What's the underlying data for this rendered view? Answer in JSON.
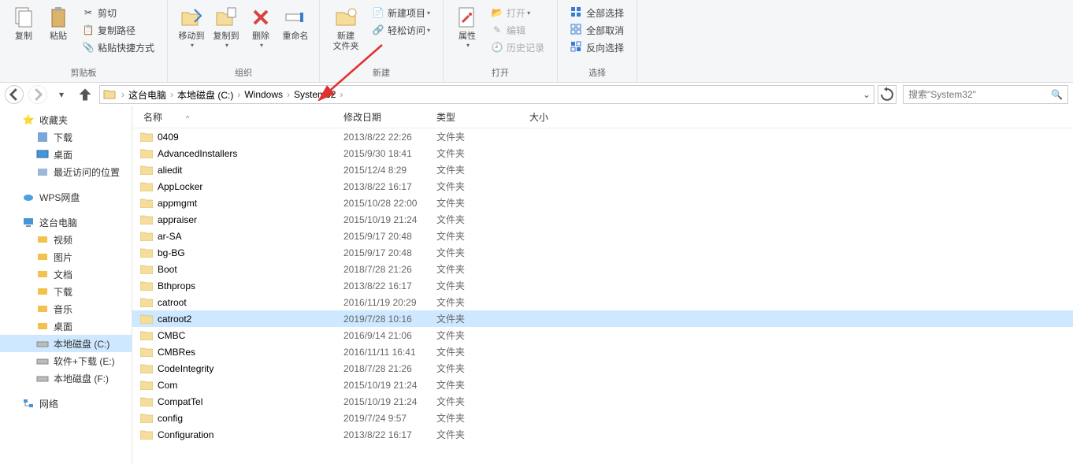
{
  "ribbon": {
    "group1": {
      "label": "剪贴板",
      "copy": "复制",
      "paste": "粘贴",
      "cut": "剪切",
      "copypath": "复制路径",
      "pasteshort": "粘贴快捷方式"
    },
    "group2": {
      "label": "组织",
      "moveto": "移动到",
      "copyto": "复制到",
      "delete": "删除",
      "rename": "重命名"
    },
    "group3": {
      "label": "新建",
      "newfolder": "新建\n文件夹",
      "newitem": "新建项目",
      "easy": "轻松访问"
    },
    "group4": {
      "label": "打开",
      "props": "属性",
      "open": "打开",
      "edit": "编辑",
      "history": "历史记录"
    },
    "group5": {
      "label": "选择",
      "sel_all": "全部选择",
      "sel_none": "全部取消",
      "sel_inv": "反向选择"
    }
  },
  "breadcrumbs": [
    "这台电脑",
    "本地磁盘 (C:)",
    "Windows",
    "System32"
  ],
  "search_placeholder": "搜索\"System32\"",
  "columns": {
    "name": "名称",
    "date": "修改日期",
    "type": "类型",
    "size": "大小"
  },
  "sidebar": {
    "fav": "收藏夹",
    "downloads": "下载",
    "desktop": "桌面",
    "recent": "最近访问的位置",
    "wps": "WPS网盘",
    "thispc": "这台电脑",
    "video": "视频",
    "pictures": "图片",
    "docs": "文档",
    "dl2": "下载",
    "music": "音乐",
    "desk2": "桌面",
    "cdrive": "本地磁盘 (C:)",
    "edrive": "软件+下载 (E:)",
    "fdrive": "本地磁盘 (F:)",
    "network": "网络"
  },
  "files": [
    {
      "name": "0409",
      "date": "2013/8/22 22:26",
      "type": "文件夹",
      "sel": false
    },
    {
      "name": "AdvancedInstallers",
      "date": "2015/9/30 18:41",
      "type": "文件夹",
      "sel": false
    },
    {
      "name": "aliedit",
      "date": "2015/12/4 8:29",
      "type": "文件夹",
      "sel": false
    },
    {
      "name": "AppLocker",
      "date": "2013/8/22 16:17",
      "type": "文件夹",
      "sel": false
    },
    {
      "name": "appmgmt",
      "date": "2015/10/28 22:00",
      "type": "文件夹",
      "sel": false
    },
    {
      "name": "appraiser",
      "date": "2015/10/19 21:24",
      "type": "文件夹",
      "sel": false
    },
    {
      "name": "ar-SA",
      "date": "2015/9/17 20:48",
      "type": "文件夹",
      "sel": false
    },
    {
      "name": "bg-BG",
      "date": "2015/9/17 20:48",
      "type": "文件夹",
      "sel": false
    },
    {
      "name": "Boot",
      "date": "2018/7/28 21:26",
      "type": "文件夹",
      "sel": false
    },
    {
      "name": "Bthprops",
      "date": "2013/8/22 16:17",
      "type": "文件夹",
      "sel": false
    },
    {
      "name": "catroot",
      "date": "2016/11/19 20:29",
      "type": "文件夹",
      "sel": false
    },
    {
      "name": "catroot2",
      "date": "2019/7/28 10:16",
      "type": "文件夹",
      "sel": true
    },
    {
      "name": "CMBC",
      "date": "2016/9/14 21:06",
      "type": "文件夹",
      "sel": false
    },
    {
      "name": "CMBRes",
      "date": "2016/11/11 16:41",
      "type": "文件夹",
      "sel": false
    },
    {
      "name": "CodeIntegrity",
      "date": "2018/7/28 21:26",
      "type": "文件夹",
      "sel": false
    },
    {
      "name": "Com",
      "date": "2015/10/19 21:24",
      "type": "文件夹",
      "sel": false
    },
    {
      "name": "CompatTel",
      "date": "2015/10/19 21:24",
      "type": "文件夹",
      "sel": false
    },
    {
      "name": "config",
      "date": "2019/7/24 9:57",
      "type": "文件夹",
      "sel": false
    },
    {
      "name": "Configuration",
      "date": "2013/8/22 16:17",
      "type": "文件夹",
      "sel": false
    }
  ]
}
